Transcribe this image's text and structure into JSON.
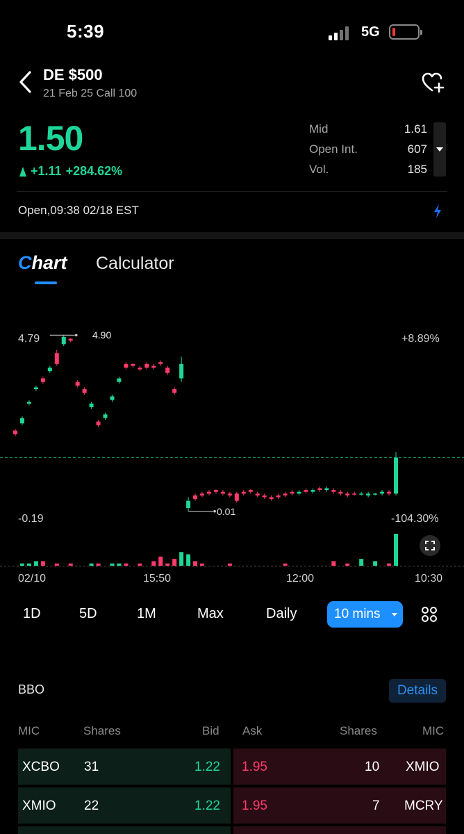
{
  "status_bar": {
    "time": "5:39",
    "network": "5G"
  },
  "header": {
    "title": "DE $500",
    "subtitle": "21 Feb 25  Call 100"
  },
  "quote": {
    "price": "1.50",
    "change": "+1.11",
    "change_pct": "+284.62%",
    "stats": [
      {
        "label": "Mid",
        "value": "1.61"
      },
      {
        "label": "Open Int.",
        "value": "607"
      },
      {
        "label": "Vol.",
        "value": "185"
      }
    ],
    "market_status": "Open,09:38 02/18 EST"
  },
  "tabs": {
    "chart": "hart",
    "chart_prefix": "C",
    "calculator": "Calculator"
  },
  "chart": {
    "y_high_label": "4.79",
    "y_low_label": "-0.19",
    "pct_high_label": "+8.89%",
    "pct_low_label": "-104.30%",
    "max_annotation": "4.90",
    "min_annotation": "0.01",
    "x_labels": [
      "02/10",
      "15:50",
      "12:00",
      "10:30"
    ]
  },
  "chart_data": {
    "type": "candlestick",
    "ylim": [
      -0.19,
      4.79
    ],
    "pct_range": [
      "+8.89%",
      "-104.30%"
    ],
    "max_marker": 4.9,
    "min_marker": 0.01,
    "x_ticks": [
      "02/10",
      "15:50",
      "12:00",
      "10:30"
    ],
    "candles": [
      {
        "o": 2.25,
        "c": 2.15,
        "h": 2.3,
        "l": 2.1
      },
      {
        "o": 2.45,
        "c": 2.6,
        "h": 2.65,
        "l": 2.4
      },
      {
        "o": 3.0,
        "c": 3.05,
        "h": 3.1,
        "l": 2.95
      },
      {
        "o": 3.4,
        "c": 3.45,
        "h": 3.5,
        "l": 3.35
      },
      {
        "o": 3.7,
        "c": 3.6,
        "h": 3.75,
        "l": 3.55
      },
      {
        "o": 3.9,
        "c": 4.0,
        "h": 4.05,
        "l": 3.85
      },
      {
        "o": 4.4,
        "c": 4.1,
        "h": 4.5,
        "l": 4.05
      },
      {
        "o": 4.65,
        "c": 4.85,
        "h": 4.9,
        "l": 4.6
      },
      {
        "o": 4.8,
        "c": 4.75,
        "h": 4.82,
        "l": 4.7
      },
      {
        "o": 3.6,
        "c": 3.5,
        "h": 3.65,
        "l": 3.45
      },
      {
        "o": 3.4,
        "c": 3.3,
        "h": 3.45,
        "l": 3.25
      },
      {
        "o": 2.9,
        "c": 3.0,
        "h": 3.05,
        "l": 2.85
      },
      {
        "o": 2.5,
        "c": 2.4,
        "h": 2.55,
        "l": 2.35
      },
      {
        "o": 2.6,
        "c": 2.7,
        "h": 2.75,
        "l": 2.55
      },
      {
        "o": 3.1,
        "c": 3.2,
        "h": 3.25,
        "l": 3.05
      },
      {
        "o": 3.6,
        "c": 3.7,
        "h": 3.75,
        "l": 3.55
      },
      {
        "o": 4.1,
        "c": 4.0,
        "h": 4.15,
        "l": 3.95
      },
      {
        "o": 4.1,
        "c": 4.05,
        "h": 4.12,
        "l": 4.0
      },
      {
        "o": 4.0,
        "c": 3.95,
        "h": 4.05,
        "l": 3.9
      },
      {
        "o": 4.1,
        "c": 4.0,
        "h": 4.15,
        "l": 3.95
      },
      {
        "o": 4.05,
        "c": 4.0,
        "h": 4.1,
        "l": 3.95
      },
      {
        "o": 4.15,
        "c": 4.1,
        "h": 4.2,
        "l": 4.05
      },
      {
        "o": 4.0,
        "c": 3.85,
        "h": 4.05,
        "l": 3.8
      },
      {
        "o": 3.4,
        "c": 3.3,
        "h": 3.45,
        "l": 3.25
      },
      {
        "o": 3.7,
        "c": 4.1,
        "h": 4.3,
        "l": 3.6
      },
      {
        "o": 0.1,
        "c": 0.3,
        "h": 0.4,
        "l": 0.01
      },
      {
        "o": 0.45,
        "c": 0.35,
        "h": 0.5,
        "l": 0.3
      },
      {
        "o": 0.5,
        "c": 0.45,
        "h": 0.55,
        "l": 0.4
      },
      {
        "o": 0.55,
        "c": 0.5,
        "h": 0.6,
        "l": 0.45
      },
      {
        "o": 0.6,
        "c": 0.55,
        "h": 0.62,
        "l": 0.5
      },
      {
        "o": 0.55,
        "c": 0.5,
        "h": 0.6,
        "l": 0.45
      },
      {
        "o": 0.5,
        "c": 0.45,
        "h": 0.55,
        "l": 0.4
      },
      {
        "o": 0.5,
        "c": 0.3,
        "h": 0.55,
        "l": 0.25
      },
      {
        "o": 0.55,
        "c": 0.5,
        "h": 0.6,
        "l": 0.45
      },
      {
        "o": 0.6,
        "c": 0.55,
        "h": 0.62,
        "l": 0.5
      },
      {
        "o": 0.5,
        "c": 0.45,
        "h": 0.55,
        "l": 0.4
      },
      {
        "o": 0.45,
        "c": 0.4,
        "h": 0.5,
        "l": 0.35
      },
      {
        "o": 0.4,
        "c": 0.35,
        "h": 0.45,
        "l": 0.3
      },
      {
        "o": 0.45,
        "c": 0.4,
        "h": 0.5,
        "l": 0.35
      },
      {
        "o": 0.5,
        "c": 0.45,
        "h": 0.55,
        "l": 0.4
      },
      {
        "o": 0.55,
        "c": 0.5,
        "h": 0.6,
        "l": 0.45
      },
      {
        "o": 0.5,
        "c": 0.55,
        "h": 0.6,
        "l": 0.45
      },
      {
        "o": 0.6,
        "c": 0.55,
        "h": 0.65,
        "l": 0.5
      },
      {
        "o": 0.55,
        "c": 0.6,
        "h": 0.65,
        "l": 0.5
      },
      {
        "o": 0.65,
        "c": 0.6,
        "h": 0.7,
        "l": 0.55
      },
      {
        "o": 0.6,
        "c": 0.65,
        "h": 0.7,
        "l": 0.55
      },
      {
        "o": 0.6,
        "c": 0.55,
        "h": 0.65,
        "l": 0.5
      },
      {
        "o": 0.55,
        "c": 0.5,
        "h": 0.6,
        "l": 0.45
      },
      {
        "o": 0.5,
        "c": 0.45,
        "h": 0.55,
        "l": 0.4
      },
      {
        "o": 0.5,
        "c": 0.48,
        "h": 0.55,
        "l": 0.45
      },
      {
        "o": 0.5,
        "c": 0.5,
        "h": 0.55,
        "l": 0.45
      },
      {
        "o": 0.45,
        "c": 0.5,
        "h": 0.55,
        "l": 0.4
      },
      {
        "o": 0.5,
        "c": 0.5,
        "h": 0.52,
        "l": 0.45
      },
      {
        "o": 0.5,
        "c": 0.55,
        "h": 0.6,
        "l": 0.45
      },
      {
        "o": 0.55,
        "c": 0.5,
        "h": 0.6,
        "l": 0.45
      },
      {
        "o": 0.5,
        "c": 1.5,
        "h": 1.65,
        "l": 0.45
      }
    ],
    "volume": [
      0,
      1,
      1,
      2,
      2,
      0,
      1,
      0,
      1,
      0,
      0,
      1,
      1,
      0,
      1,
      1,
      1,
      0,
      1,
      0,
      2,
      4,
      1,
      3,
      6,
      5,
      2,
      1,
      0,
      0,
      0,
      1,
      0,
      0,
      0,
      0,
      0,
      0,
      0,
      1,
      0,
      0,
      0,
      0,
      0,
      0,
      2,
      0,
      1,
      0,
      3,
      0,
      2,
      0,
      1,
      14
    ]
  },
  "timeframes": [
    "1D",
    "5D",
    "1M",
    "Max",
    "Daily"
  ],
  "active_timeframe": "10 mins",
  "bbo": {
    "title": "BBO",
    "details_label": "Details",
    "columns": [
      "MIC",
      "Shares",
      "Bid",
      "Ask",
      "Shares",
      "MIC"
    ],
    "rows": [
      {
        "bid_mic": "XCBO",
        "bid_shares": "31",
        "bid": "1.22",
        "ask": "1.95",
        "ask_shares": "10",
        "ask_mic": "XMIO"
      },
      {
        "bid_mic": "XMIO",
        "bid_shares": "22",
        "bid": "1.22",
        "ask": "1.95",
        "ask_shares": "7",
        "ask_mic": "MCRY"
      }
    ]
  },
  "colors": {
    "up": "#1fd69a",
    "down": "#ff3b6b",
    "accent": "#1e8fff"
  },
  "icons": [
    "back-chevron-icon",
    "heart-plus-icon",
    "bolt-icon",
    "expand-icon",
    "grid-icon"
  ]
}
